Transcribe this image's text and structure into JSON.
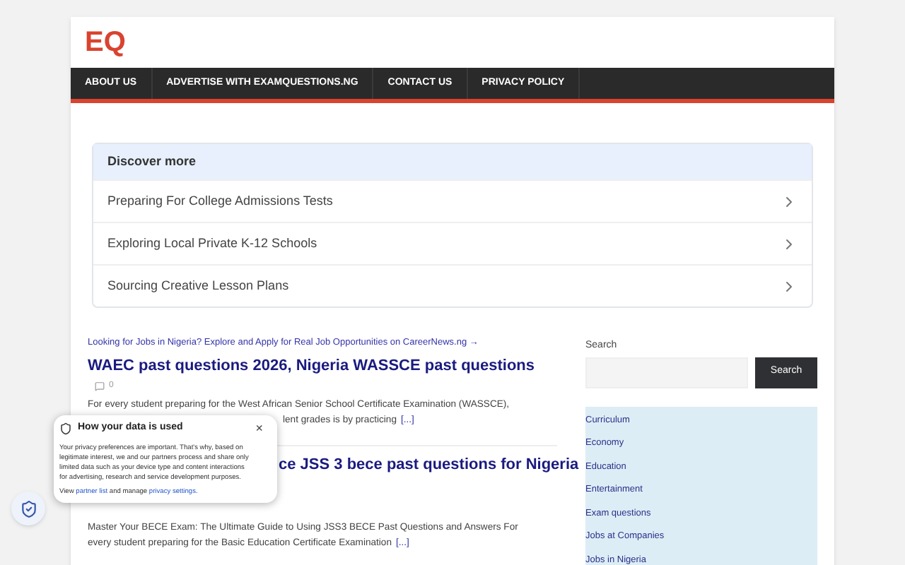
{
  "logo": "EQ",
  "nav": [
    {
      "label": "ABOUT US"
    },
    {
      "label": "ADVERTISE WITH EXAMQUESTIONS.NG"
    },
    {
      "label": "CONTACT US"
    },
    {
      "label": "PRIVACY POLICY"
    }
  ],
  "discover": {
    "title": "Discover more",
    "items": [
      "Preparing For College Admissions Tests",
      "Exploring Local Private K-12 Schools",
      "Sourcing Creative Lesson Plans"
    ]
  },
  "promo_link": "Looking for Jobs in Nigeria? Explore and Apply for Real Job Opportunities on CareerNews.ng →",
  "articles": [
    {
      "title": "WAEC past questions 2026, Nigeria WASSCE past questions",
      "comments": "0",
      "excerpt_lines": [
        "For every student preparing for the West African Senior School Certificate Examination (WASSCE),",
        "lent grades is by practicing"
      ],
      "more": "[...]"
    },
    {
      "title": "ce JSS 3 bece past questions for Nigeria",
      "excerpt_lines": [
        "Master Your BECE Exam: The Ultimate Guide to Using JSS3 BECE Past Questions and Answers For",
        "every student preparing for the Basic Education Certificate Examination"
      ],
      "more": "[...]"
    }
  ],
  "sidebar": {
    "search_label": "Search",
    "search_button": "Search",
    "categories": [
      "Curriculum",
      "Economy",
      "Education",
      "Entertainment",
      "Exam questions",
      "Jobs at Companies",
      "Jobs in Nigeria"
    ]
  },
  "privacy_popup": {
    "title": "How your data is used",
    "close": "×",
    "body": "Your privacy preferences are important. That's why, based on legitimate interest, we and our partners process and share only limited data such as your device type and content interactions for advertising, research and service development purposes.",
    "footer_prefix": "View",
    "partner_link": "partner list",
    "footer_middle": "and manage",
    "settings_link": "privacy settings."
  }
}
